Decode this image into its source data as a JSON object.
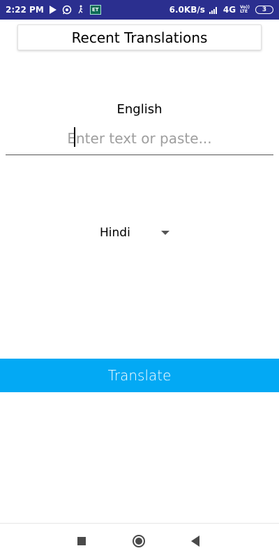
{
  "status_bar": {
    "time": "2:22 PM",
    "net_speed": "6.0KB/s",
    "network": "4G",
    "volte_top": "Vo))",
    "volte_bottom": "LTE",
    "battery": "3",
    "et_label": "ET",
    "icons": [
      "play-store-icon",
      "whatsapp-icon",
      "running-person-icon",
      "et-app-icon",
      "signal-icon"
    ]
  },
  "header": {
    "recent_label": "Recent Translations"
  },
  "source": {
    "language": "English",
    "input_value": "",
    "placeholder": "Enter text or paste..."
  },
  "target": {
    "language": "Hindi"
  },
  "actions": {
    "translate_label": "Translate"
  },
  "colors": {
    "status_bar": "#2b2f8f",
    "accent": "#03a9f4"
  },
  "nav": {
    "icons": [
      "recent-apps-icon",
      "home-icon",
      "back-icon"
    ]
  }
}
